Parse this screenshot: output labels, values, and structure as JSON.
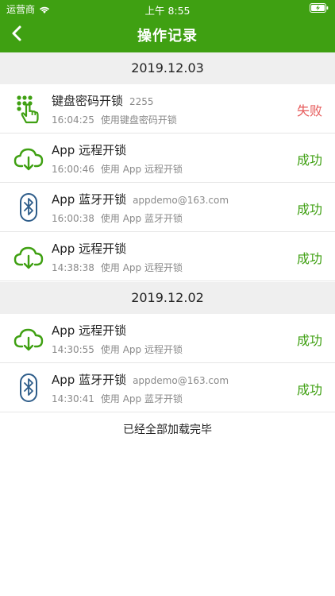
{
  "status_bar": {
    "carrier": "运营商",
    "time": "上午 8:55"
  },
  "nav": {
    "title": "操作记录"
  },
  "colors": {
    "brand": "#3fa012",
    "fail": "#e65a5a",
    "bluetooth": "#2e5d8a"
  },
  "groups": [
    {
      "date": "2019.12.03",
      "records": [
        {
          "icon": "keypad-icon",
          "title": "键盘密码开锁",
          "extra": "2255",
          "time": "16:04:25",
          "desc": "使用键盘密码开锁",
          "result": "失败"
        },
        {
          "icon": "cloud-download-icon",
          "title": "App 远程开锁",
          "extra": "",
          "time": "16:00:46",
          "desc": "使用 App 远程开锁",
          "result": "成功"
        },
        {
          "icon": "bluetooth-icon",
          "title": "App 蓝牙开锁",
          "extra": "appdemo@163.com",
          "time": "16:00:38",
          "desc": "使用 App 蓝牙开锁",
          "result": "成功"
        },
        {
          "icon": "cloud-download-icon",
          "title": "App 远程开锁",
          "extra": "",
          "time": "14:38:38",
          "desc": "使用 App 远程开锁",
          "result": "成功"
        }
      ]
    },
    {
      "date": "2019.12.02",
      "records": [
        {
          "icon": "cloud-download-icon",
          "title": "App 远程开锁",
          "extra": "",
          "time": "14:30:55",
          "desc": "使用 App 远程开锁",
          "result": "成功"
        },
        {
          "icon": "bluetooth-icon",
          "title": "App 蓝牙开锁",
          "extra": "appdemo@163.com",
          "time": "14:30:41",
          "desc": "使用 App 蓝牙开锁",
          "result": "成功"
        }
      ]
    }
  ],
  "footer": "已经全部加载完毕"
}
